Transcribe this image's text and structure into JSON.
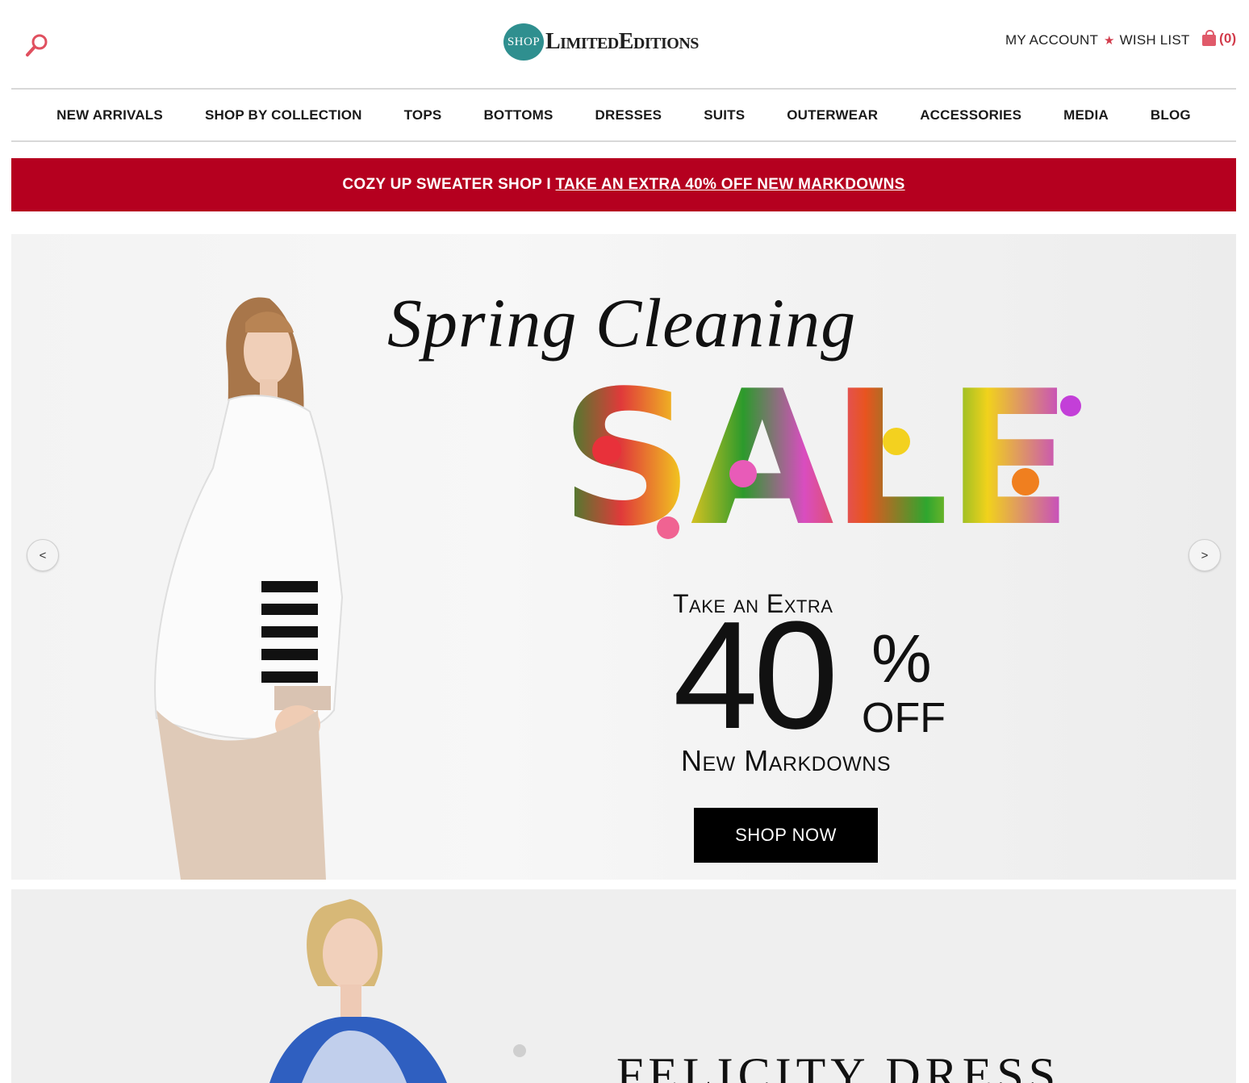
{
  "header": {
    "logo_badge": "SHOP",
    "logo_text": "LimitedEditions",
    "my_account": "MY ACCOUNT",
    "wish_list": "WISH LIST",
    "cart_count": "(0)"
  },
  "nav": {
    "items": [
      "NEW ARRIVALS",
      "SHOP BY COLLECTION",
      "TOPS",
      "BOTTOMS",
      "DRESSES",
      "SUITS",
      "OUTERWEAR",
      "ACCESSORIES",
      "MEDIA",
      "BLOG"
    ]
  },
  "promo": {
    "prefix": "COZY UP SWEATER SHOP I ",
    "link": "TAKE AN EXTRA 40% OFF NEW MARKDOWNS"
  },
  "hero": {
    "title": "Spring Cleaning",
    "sale": "SALE",
    "take_extra": "Take an Extra",
    "percent_value": "40",
    "percent_sign": "%",
    "off": "OFF",
    "markdowns": "New Markdowns",
    "cta": "SHOP NOW",
    "prev": "<",
    "next": ">"
  },
  "hero2": {
    "title": "FELICITY DRESS"
  },
  "colors": {
    "promo_bg": "#b5001f",
    "accent": "#d23c4c",
    "logo_teal": "#2f8f8f"
  }
}
